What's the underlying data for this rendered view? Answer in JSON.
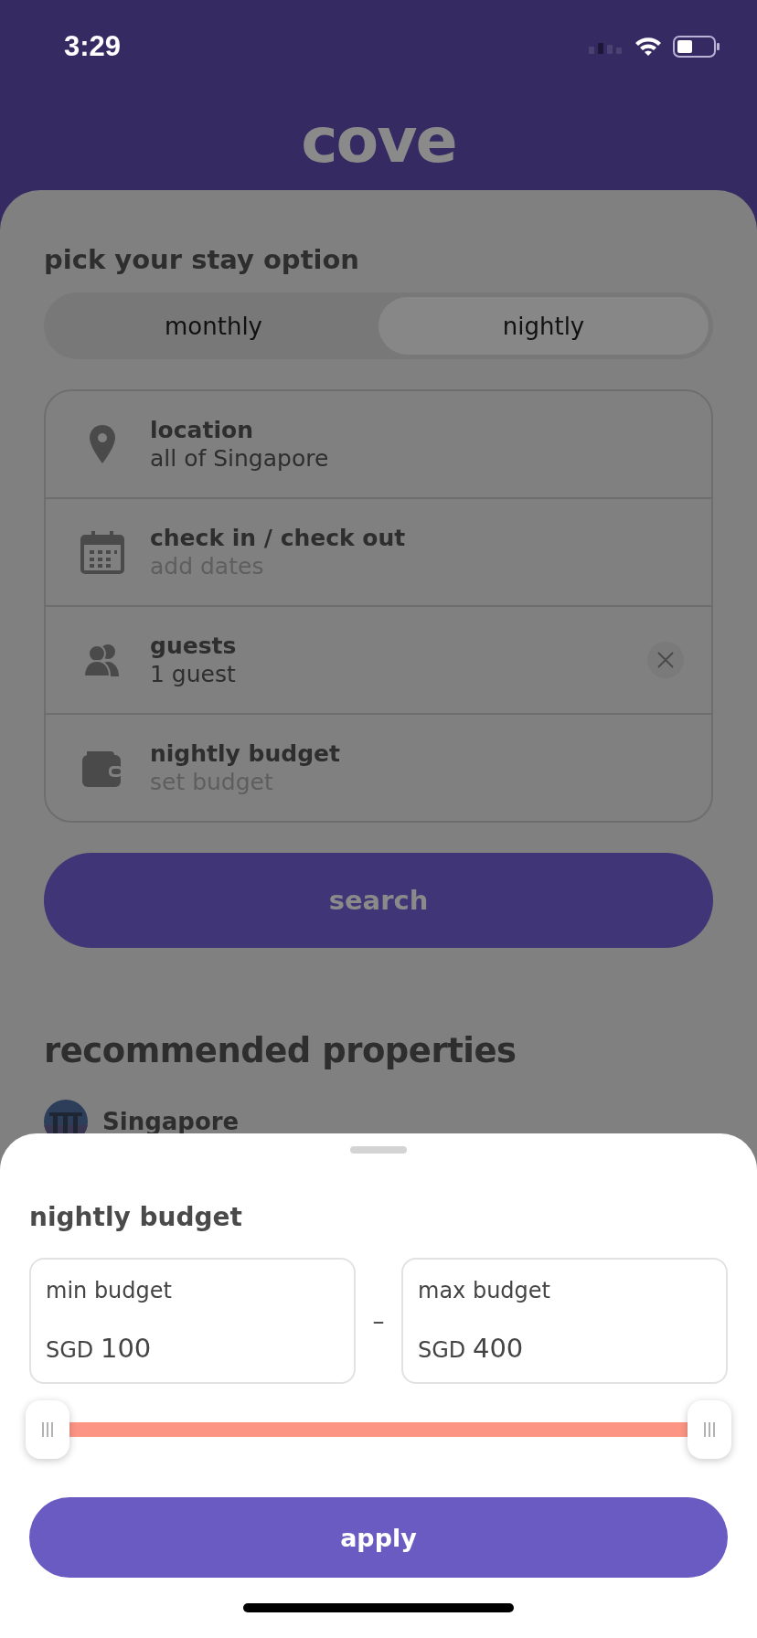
{
  "status_bar": {
    "time": "3:29"
  },
  "header": {
    "logo": "cove"
  },
  "stay": {
    "title": "pick your stay option",
    "options": [
      {
        "label": "monthly",
        "selected": false
      },
      {
        "label": "nightly",
        "selected": true
      }
    ]
  },
  "form": [
    {
      "kind": "location",
      "label": "location",
      "value": "all of Singapore",
      "clearable": false
    },
    {
      "kind": "dates",
      "label": "check in / check out",
      "placeholder": "add dates",
      "clearable": false
    },
    {
      "kind": "guests",
      "label": "guests",
      "value": "1 guest",
      "clearable": true
    },
    {
      "kind": "budget",
      "label": "nightly budget",
      "placeholder": "set budget",
      "clearable": false
    }
  ],
  "search_button": "search",
  "recommended": {
    "title": "recommended properties",
    "places": [
      {
        "name": "Singapore",
        "kind": "picture"
      }
    ]
  },
  "sheet": {
    "title": "nightly budget",
    "fields": [
      {
        "label": "min budget",
        "currency": "SGD",
        "value": "100"
      },
      {
        "label": "max budget",
        "currency": "SGD",
        "value": "400"
      }
    ],
    "separator": "–",
    "thumbs": [
      {
        "level": 0
      },
      {
        "level": 1
      }
    ],
    "apply_button": "apply"
  }
}
